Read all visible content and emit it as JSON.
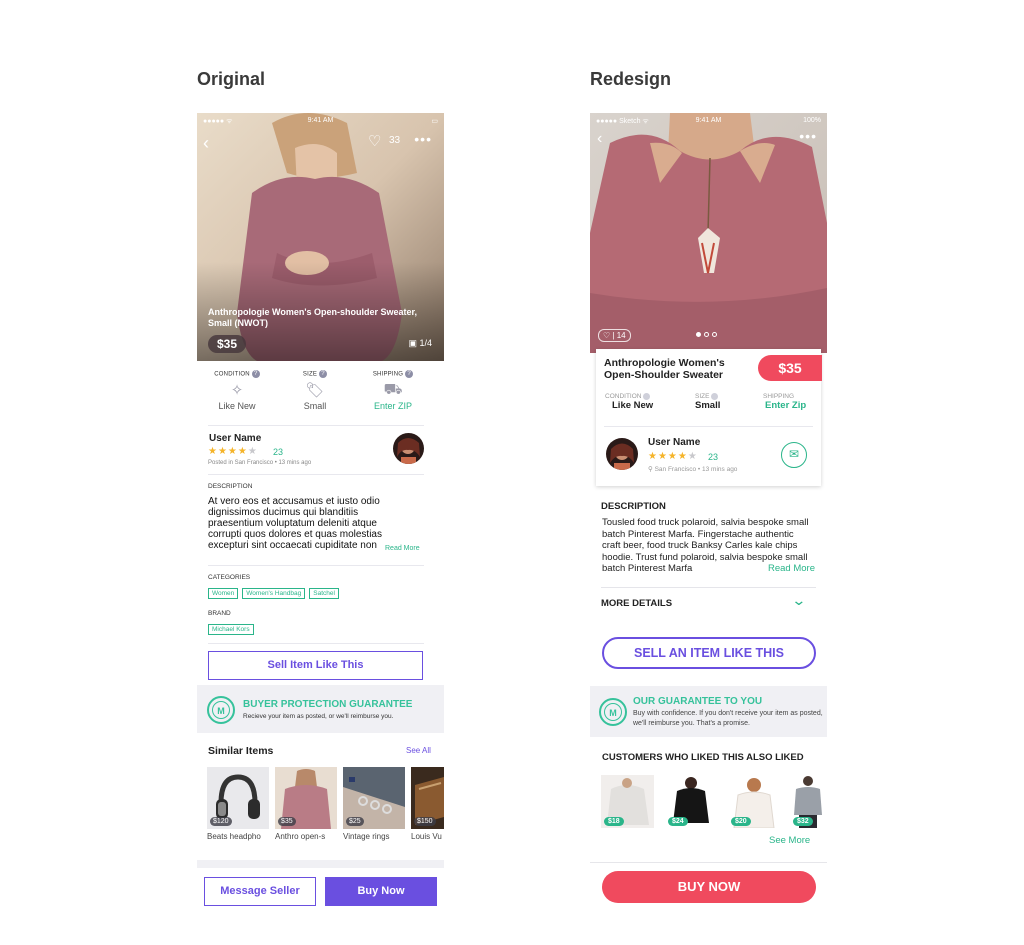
{
  "headings": {
    "original": "Original",
    "redesign": "Redesign"
  },
  "status_bar": {
    "signal": "●●●●● ᯤ",
    "time": "9:41 AM",
    "carrier_b": "●●●●● Sketch ᯤ",
    "battery_b": "100%"
  },
  "colors": {
    "brand_purple": "#6a4fe0",
    "green": "#2ab58a",
    "pink": "#f04a5e",
    "star": "#f5b42a"
  },
  "original": {
    "likes": "33",
    "title": "Anthropologie Women's Open-shoulder Sweater, Small (NWOT)",
    "price": "$35",
    "pager": "1/4",
    "attributes": [
      {
        "label": "CONDITION",
        "value": "Like New",
        "icon": "sparkle-icon"
      },
      {
        "label": "SIZE",
        "value": "Small",
        "icon": "tag-icon"
      },
      {
        "label": "SHIPPING",
        "value": "Enter ZIP",
        "icon": "truck-icon"
      }
    ],
    "seller": {
      "name": "User Name",
      "rating": 4,
      "rating_count": "23",
      "posted": "Posted in San Francisco • 13 mins ago"
    },
    "description_heading": "DESCRIPTION",
    "description": "At vero eos et accusamus et iusto odio dignissimos ducimus qui blanditiis praesentium voluptatum deleniti atque corrupti quos dolores et quas molestias excepturi sint occaecati cupiditate non",
    "read_more": "Read More",
    "categories_heading": "CATEGORIES",
    "categories": [
      "Women",
      "Women's Handbag",
      "Satchel"
    ],
    "brand_heading": "BRAND",
    "brand": "Michael Kors",
    "sell_button": "Sell Item Like This",
    "guarantee_title": "BUYER PROTECTION GUARANTEE",
    "guarantee_sub": "Recieve your item as posted, or we'll reimburse you.",
    "similar_title": "Similar Items",
    "see_all": "See All",
    "similar": [
      {
        "price": "$120",
        "label": "Beats headpho"
      },
      {
        "price": "$35",
        "label": "Anthro open-s"
      },
      {
        "price": "$25",
        "label": "Vintage rings"
      },
      {
        "price": "$150",
        "label": "Louis Vu"
      }
    ],
    "message_button": "Message Seller",
    "buy_button": "Buy Now"
  },
  "redesign": {
    "likes": "14",
    "title": "Anthropologie Women's Open-Shoulder Sweater",
    "price": "$35",
    "attributes": [
      {
        "label": "CONDITION",
        "value": "Like New"
      },
      {
        "label": "SIZE",
        "value": "Small"
      },
      {
        "label": "SHIPPING",
        "value": "Enter Zip"
      }
    ],
    "seller": {
      "name": "User Name",
      "rating": 4,
      "rating_count": "23",
      "posted": "San Francisco • 13 mins ago"
    },
    "description_heading": "DESCRIPTION",
    "description": "Tousled food truck polaroid, salvia bespoke small batch Pinterest Marfa. Fingerstache authentic craft beer, food truck Banksy Carles kale chips hoodie. Trust fund polaroid, salvia bespoke small batch Pinterest Marfa",
    "read_more": "Read More",
    "more_details": "MORE DETAILS",
    "sell_button": "SELL AN ITEM LIKE THIS",
    "guarantee_title": "OUR GUARANTEE TO YOU",
    "guarantee_sub": "Buy with confidence. If you don't receive your item as posted, we'll reimburse you. That's a promise.",
    "customers_title": "CUSTOMERS WHO LIKED THIS ALSO LIKED",
    "customers": [
      {
        "price": "$18"
      },
      {
        "price": "$24"
      },
      {
        "price": "$20"
      },
      {
        "price": "$32"
      }
    ],
    "see_more": "See More",
    "buy_button": "BUY NOW"
  }
}
